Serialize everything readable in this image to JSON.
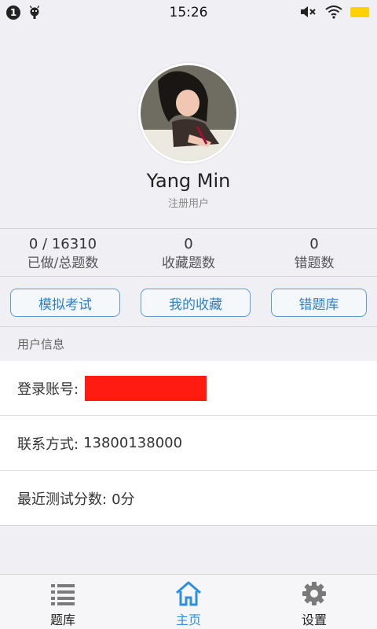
{
  "status_bar": {
    "notification_count": "1",
    "time": "15:26"
  },
  "profile": {
    "name": "Yang Min",
    "user_type": "注册用户"
  },
  "stats": [
    {
      "value": "0 / 16310",
      "label": "已做/总题数"
    },
    {
      "value": "0",
      "label": "收藏题数"
    },
    {
      "value": "0",
      "label": "错题数"
    }
  ],
  "actions": {
    "mock_exam": "模拟考试",
    "my_favorites": "我的收藏",
    "wrong_questions": "错题库"
  },
  "user_info": {
    "section_title": "用户信息",
    "account_label": "登录账号:",
    "contact_label": "联系方式:",
    "contact_value": "13800138000",
    "recent_score_label": "最近测试分数:",
    "recent_score_value": "0分"
  },
  "tabs": [
    {
      "label": "题库",
      "icon": "list-icon",
      "active": false
    },
    {
      "label": "主页",
      "icon": "home-icon",
      "active": true
    },
    {
      "label": "设置",
      "icon": "gear-icon",
      "active": false
    }
  ],
  "colors": {
    "accent": "#2b8fe0",
    "button_border": "#5b9bd8",
    "redaction": "#ff1a12",
    "battery": "#ffd200"
  }
}
